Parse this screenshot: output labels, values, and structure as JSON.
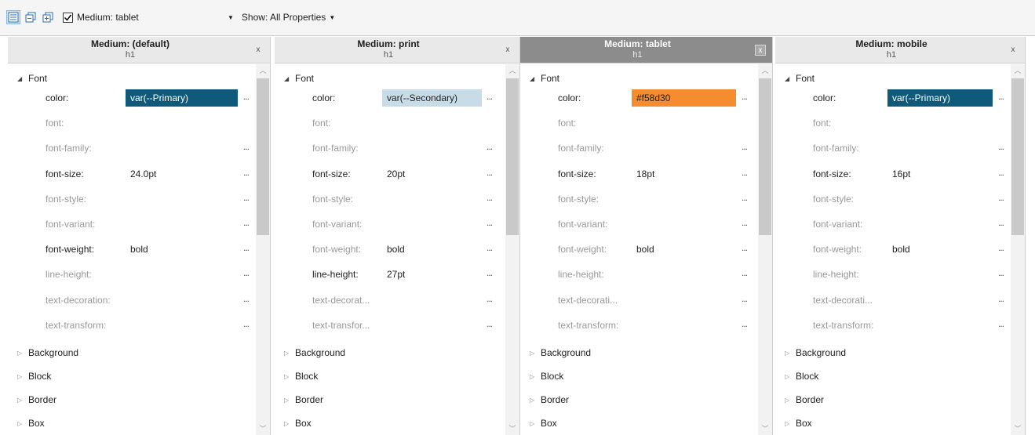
{
  "toolbar": {
    "medium_selected": "Medium: tablet",
    "show_label": "Show: All Properties"
  },
  "panels": [
    {
      "title": "Medium: (default)",
      "subtitle": "h1",
      "close": "x",
      "color": "var(--Primary)",
      "font_size": "24.0pt",
      "font_weight": "bold",
      "line_height": "",
      "names": {
        "text_decoration": "text-decoration:",
        "text_transform": "text-transform:"
      }
    },
    {
      "title": "Medium: print",
      "subtitle": "h1",
      "close": "x",
      "color": "var(--Secondary)",
      "font_size": "20pt",
      "font_weight": "bold",
      "line_height": "27pt",
      "names": {
        "text_decoration": "text-decorat...",
        "text_transform": "text-transfor..."
      }
    },
    {
      "title": "Medium: tablet",
      "subtitle": "h1",
      "close": "x",
      "color": "#f58d30",
      "font_size": "18pt",
      "font_weight": "bold",
      "line_height": "",
      "names": {
        "text_decoration": "text-decorati...",
        "text_transform": "text-transform:"
      }
    },
    {
      "title": "Medium: mobile",
      "subtitle": "h1",
      "close": "x",
      "color": "var(--Primary)",
      "font_size": "16pt",
      "font_weight": "bold",
      "line_height": "",
      "names": {
        "text_decoration": "text-decorati...",
        "text_transform": "text-transform:"
      }
    }
  ],
  "labels": {
    "font": "Font",
    "color": "color:",
    "font_prop": "font:",
    "font_family": "font-family:",
    "font_size": "font-size:",
    "font_style": "font-style:",
    "font_variant": "font-variant:",
    "font_weight": "font-weight:",
    "line_height": "line-height:",
    "more": "...",
    "background": "Background",
    "block": "Block",
    "border": "Border",
    "box": "Box"
  },
  "colors": {
    "primary": "#0f5a7a",
    "secondary": "#c7dce7",
    "orange": "#f58d30",
    "selected_header": "#8c8c8c"
  }
}
